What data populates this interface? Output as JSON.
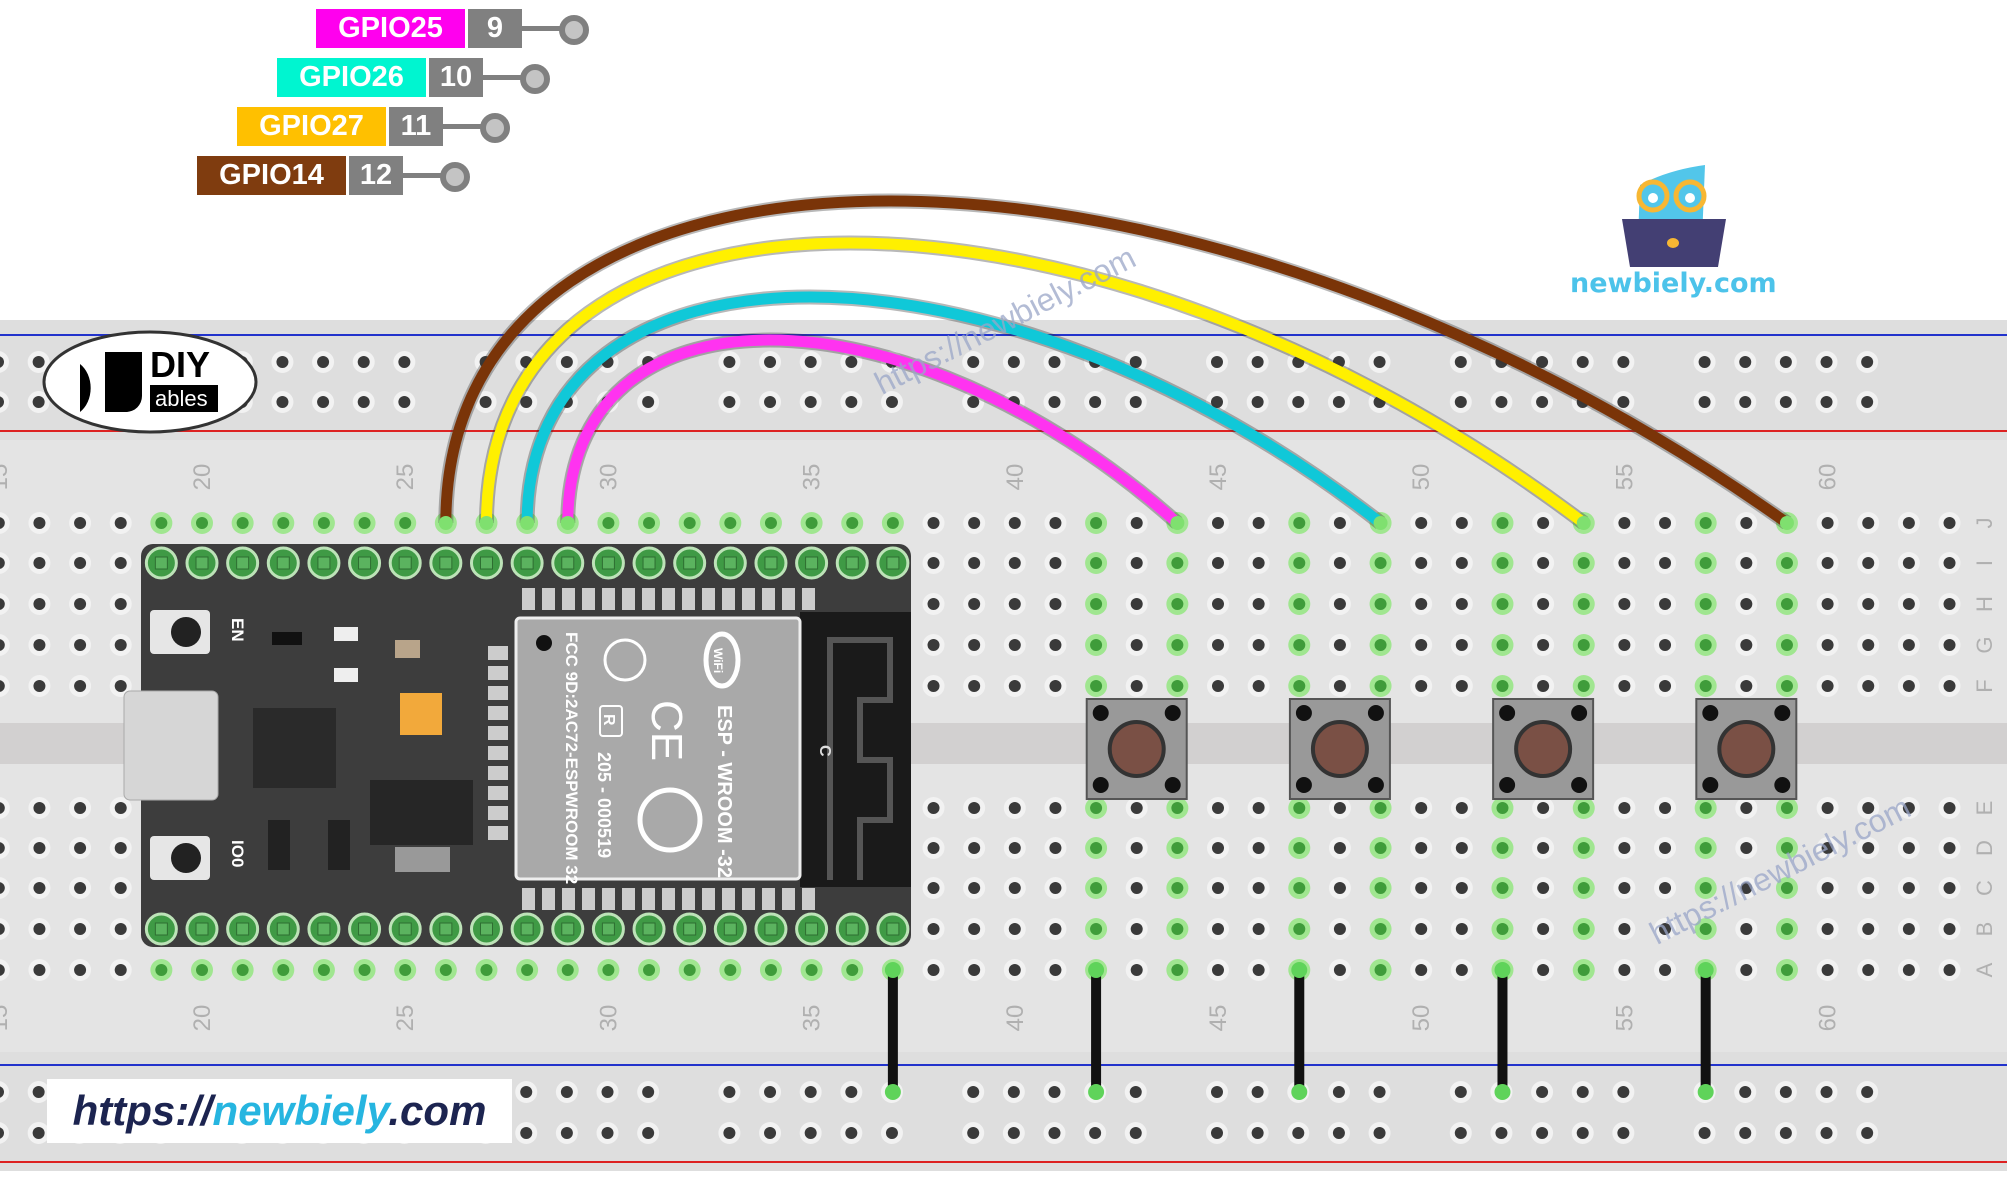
{
  "pin_labels": [
    {
      "name": "GPIO25",
      "pin": "9",
      "color": "#ff00ee"
    },
    {
      "name": "GPIO26",
      "pin": "10",
      "color": "#00f5d0"
    },
    {
      "name": "GPIO27",
      "pin": "11",
      "color": "#ffc000"
    },
    {
      "name": "GPIO14",
      "pin": "12",
      "color": "#7f3c0f"
    }
  ],
  "pin_number_color": "#808080",
  "breadboard": {
    "column_numbers": [
      "15",
      "20",
      "25",
      "30",
      "35",
      "40",
      "45",
      "50",
      "55",
      "60"
    ],
    "row_letters_top": [
      "J",
      "I",
      "H",
      "G",
      "F"
    ],
    "row_letters_bottom": [
      "E",
      "D",
      "C",
      "B",
      "A"
    ]
  },
  "wires": [
    {
      "color": "#ff33f0",
      "from_col": 29,
      "to_col": 44
    },
    {
      "color": "#10c8d8",
      "from_col": 28,
      "to_col": 49
    },
    {
      "color": "#fff000",
      "from_col": 27,
      "to_col": 54
    },
    {
      "color": "#7a3408",
      "from_col": 26,
      "to_col": 59
    }
  ],
  "ground_wire_cols": [
    37,
    42,
    47,
    52,
    57
  ],
  "buttons": [
    {
      "cols": [
        42,
        44
      ]
    },
    {
      "cols": [
        47,
        49
      ]
    },
    {
      "cols": [
        52,
        54
      ]
    },
    {
      "cols": [
        57,
        59
      ]
    }
  ],
  "esp32": {
    "module_name": "ESP - WROOM -32",
    "fcc": "FCC 9D:2AC72-ESPWROOM 32",
    "cert": "205 - 000519",
    "r_mark": "R",
    "ce_mark": "CE",
    "wifi": "WiFi",
    "antenna_mark": "C",
    "en_label": "EN",
    "io0_label": "IO0"
  },
  "logos": {
    "diy_top": "DIY",
    "diy_bottom": "ables",
    "newbiely": "newbiely.com"
  },
  "watermark": "https://newbiely.com",
  "url_box": {
    "prefix": "https://",
    "name": "newbiely",
    "suffix": ".com"
  }
}
